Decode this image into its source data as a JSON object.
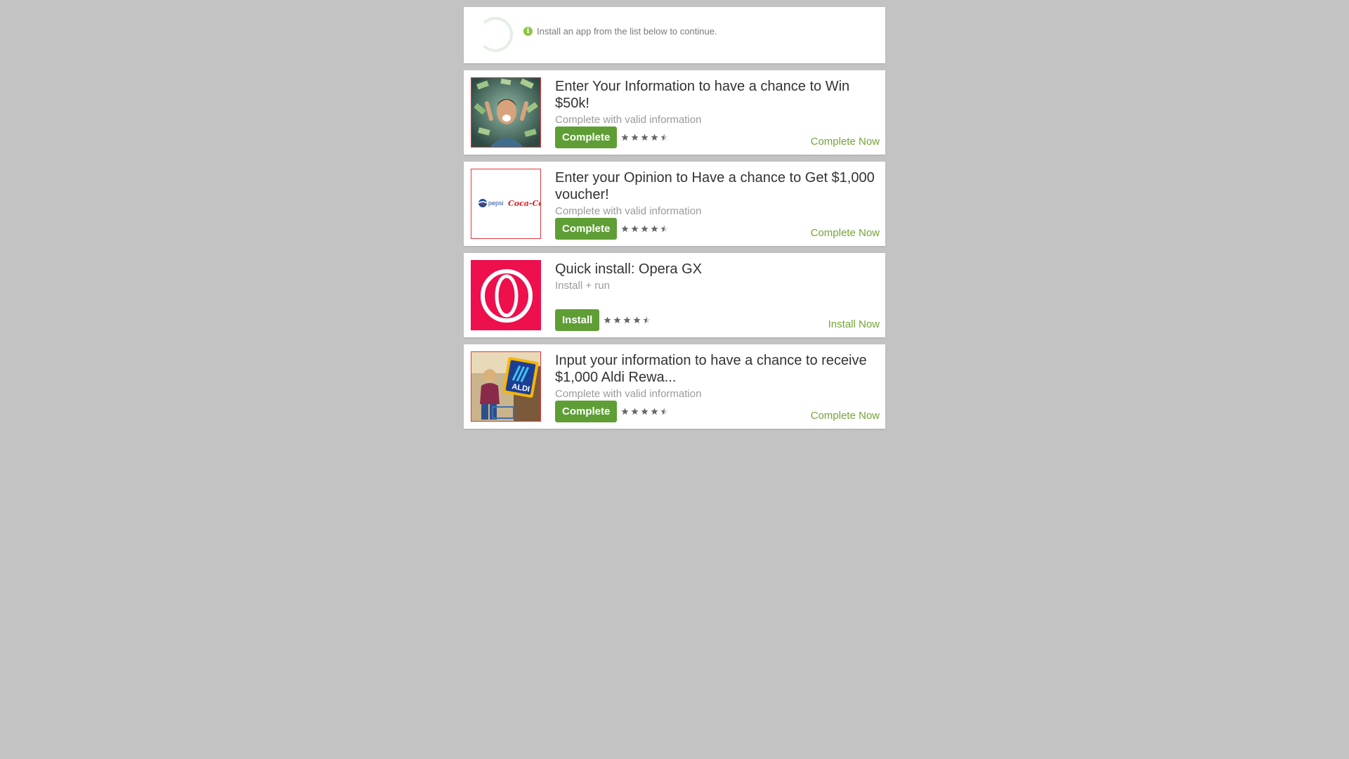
{
  "status": {
    "message": "Install an app from the list below to continue.",
    "spinner_icon": "loading-spinner-icon",
    "info_icon": "info-circle-icon"
  },
  "colors": {
    "background": "#c3c3c3",
    "button": "#5f9e35",
    "link": "#73a534",
    "thumb_border": "#e4373e"
  },
  "offers": [
    {
      "title": "Enter Your Information to have a chance to Win $50k!",
      "subtitle": "Complete with valid information",
      "button": "Complete",
      "cta": "Complete Now",
      "rating": 4.5,
      "thumb_icon": "money-winner-image"
    },
    {
      "title": "Enter your Opinion to Have a chance to Get $1,000 voucher!",
      "subtitle": "Complete with valid information",
      "button": "Complete",
      "cta": "Complete Now",
      "rating": 4.5,
      "thumb_icon": "pepsi-cocacola-logo",
      "thumb_text_1": "pepsi",
      "thumb_text_2": "Coca-Cola"
    },
    {
      "title": "Quick install: Opera GX",
      "subtitle": "Install + run",
      "button": "Install",
      "cta": "Install Now",
      "rating": 4.5,
      "thumb_icon": "opera-gx-logo"
    },
    {
      "title": "Input your information to have a chance to receive $1,000 Aldi Rewa...",
      "subtitle": "Complete with valid information",
      "button": "Complete",
      "cta": "Complete Now",
      "rating": 4.5,
      "thumb_icon": "aldi-shopper-image",
      "thumb_text_1": "ALDI"
    }
  ]
}
